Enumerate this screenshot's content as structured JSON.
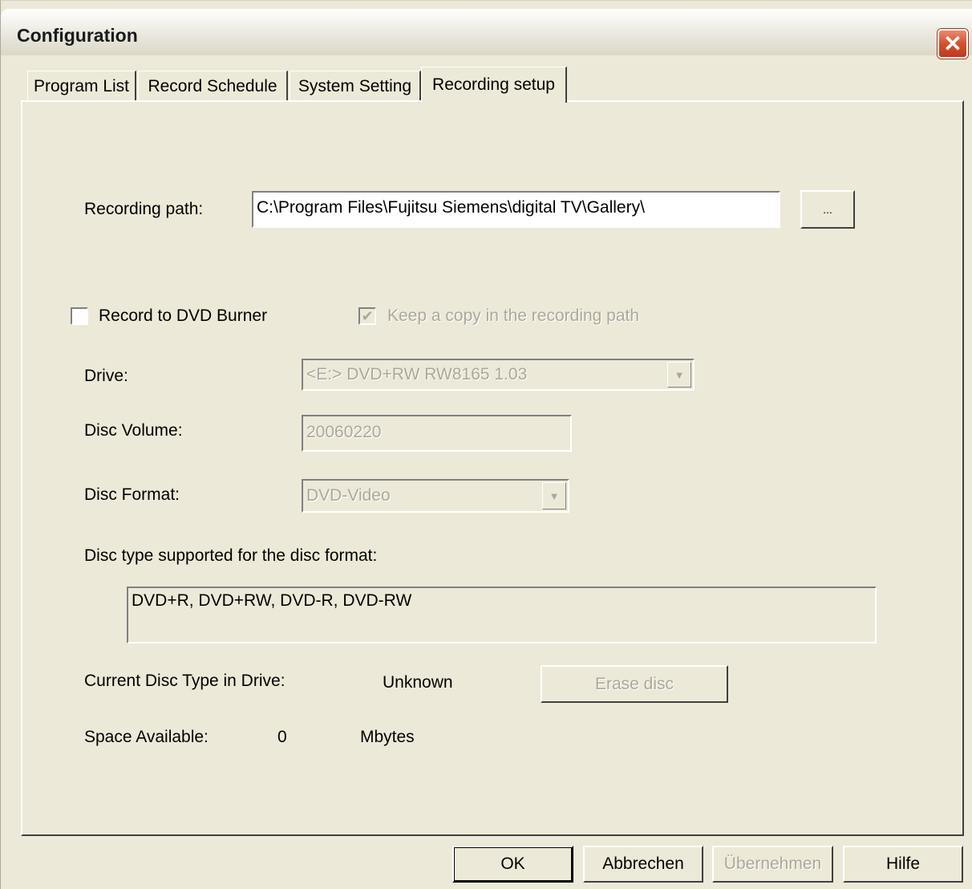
{
  "window": {
    "title": "Configuration",
    "close_glyph": "✕"
  },
  "tabs": [
    {
      "label": "Program List"
    },
    {
      "label": "Record Schedule"
    },
    {
      "label": "System Setting"
    },
    {
      "label": "Recording setup",
      "active": true
    }
  ],
  "recording_path": {
    "label": "Recording path:",
    "value": "C:\\Program Files\\Fujitsu Siemens\\digital TV\\Gallery\\",
    "browse_label": "..."
  },
  "record_to_dvd": {
    "label": "Record to DVD Burner",
    "checked": false,
    "glyph": ""
  },
  "keep_copy": {
    "label": "Keep a copy in the recording path",
    "checked": true,
    "glyph": "✔"
  },
  "drive": {
    "label": "Drive:",
    "value": "<E:>  DVD+RW RW8165  1.03",
    "arrow": "▼"
  },
  "disc_volume": {
    "label": "Disc Volume:",
    "value": "20060220"
  },
  "disc_format": {
    "label": "Disc Format:",
    "value": "DVD-Video",
    "arrow": "▼"
  },
  "disc_types": {
    "label": "Disc type supported for the disc format:",
    "value": "DVD+R, DVD+RW, DVD-R, DVD-RW"
  },
  "current_disc": {
    "label": "Current Disc Type in Drive:",
    "value": "Unknown",
    "erase_label": "Erase disc"
  },
  "space": {
    "label": "Space Available:",
    "value": "0",
    "unit": "Mbytes"
  },
  "buttons": {
    "ok": "OK",
    "cancel": "Abbrechen",
    "apply": "Übernehmen",
    "help": "Hilfe"
  },
  "colors": {
    "dialog_bg": "#ece9d8",
    "disabled_text": "#aca899",
    "close_button": "#d4522e"
  }
}
